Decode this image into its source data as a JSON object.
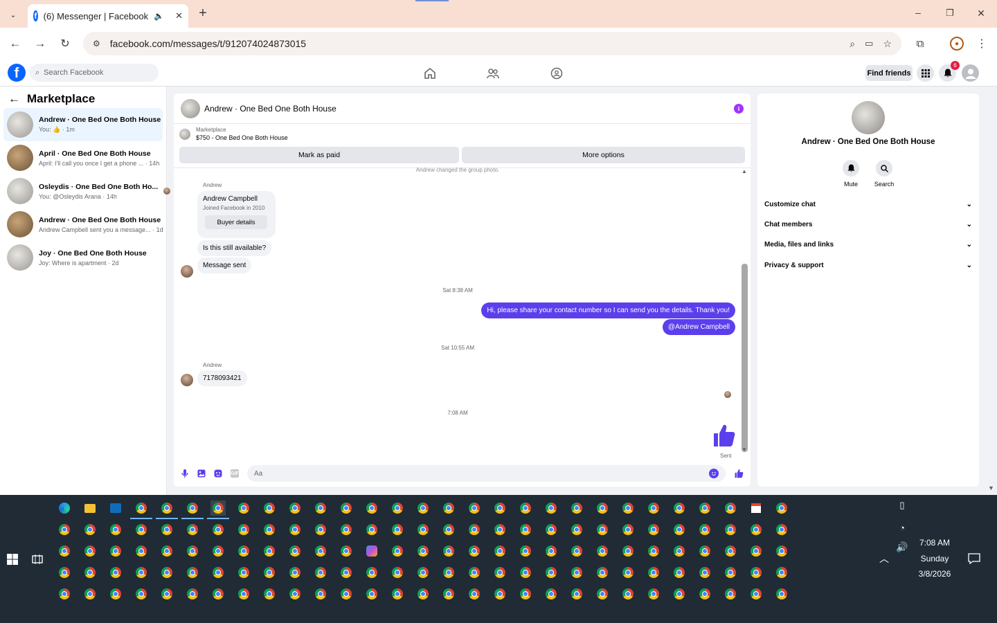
{
  "browser": {
    "tab_title": "(6) Messenger | Facebook",
    "tab_favicon": "facebook-icon",
    "url": "facebook.com/messages/t/912074024873015"
  },
  "fb": {
    "search_placeholder": "Search Facebook",
    "find_friends": "Find friends",
    "notif_count": "6"
  },
  "left": {
    "title": "Marketplace",
    "items": [
      {
        "title": "Andrew · One Bed One Both House",
        "sub": "You: 👍 · 1m",
        "thumb": "light"
      },
      {
        "title": "April · One Bed One Both House",
        "sub": "April: I'll call you once I get a phone ... · 14h",
        "thumb": "dark"
      },
      {
        "title": "Osleydis · One Bed One Both Ho...",
        "sub": "You: @Osleydis Arana · 14h",
        "thumb": "light"
      },
      {
        "title": "Andrew · One Bed One Both House",
        "sub": "Andrew Campbell sent you a message... · 1d",
        "thumb": "dark"
      },
      {
        "title": "Joy · One Bed One Both House",
        "sub": "Joy: Where is apartment · 2d",
        "thumb": "light"
      }
    ]
  },
  "chat": {
    "title": "Andrew · One Bed One Both House",
    "marketplace_label": "Marketplace",
    "listing": "$750 - One Bed One Both House",
    "mark_paid": "Mark as paid",
    "more_options": "More options",
    "sys_photo": "Andrew changed the group photo.",
    "sender1": "Andrew",
    "card_name": "Andrew Campbell",
    "card_joined": "Joined Facebook in 2010",
    "buyer_details": "Buyer details",
    "msg_available": "Is this still available?",
    "msg_sent": "Message sent",
    "time1": "Sat 8:38 AM",
    "out1": "Hi, please share your contact number so I can send you the details. Thank you!",
    "out2": "@Andrew Campbell",
    "time2": "Sat 10:55 AM",
    "sender2": "Andrew",
    "msg_number": "7178093421",
    "time3": "7:08 AM",
    "sent_label": "Sent",
    "composer_placeholder": "Aa",
    "accent": "#5b3fed"
  },
  "right": {
    "name": "Andrew · One Bed One Both House",
    "mute": "Mute",
    "search": "Search",
    "sections": [
      "Customize chat",
      "Chat members",
      "Media, files and links",
      "Privacy & support"
    ]
  },
  "taskbar": {
    "time": "7:08 AM",
    "day": "Sunday",
    "date": "3/8/2026"
  }
}
